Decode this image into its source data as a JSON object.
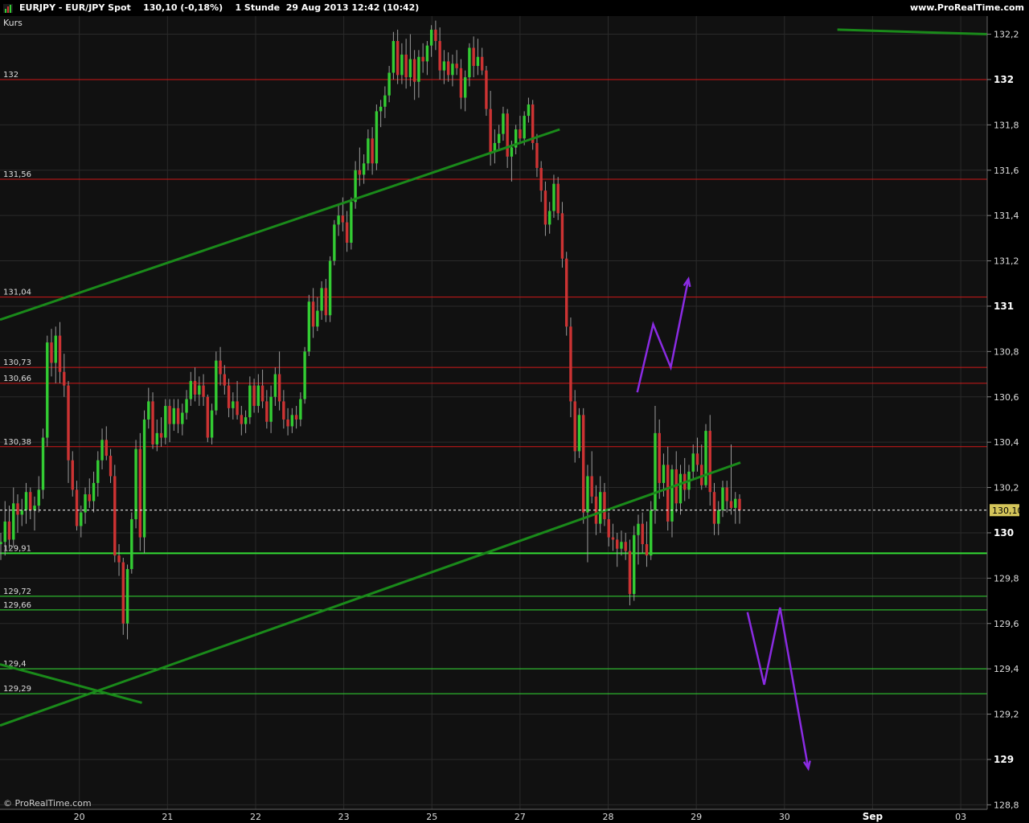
{
  "header": {
    "title": "EURJPY - EUR/JPY Spot    130,10 (-0,18%)    1 Stunde  29 Aug 2013 12:42 (10:42)",
    "site": "www.ProRealTime.com",
    "icon": "bar-chart-icon"
  },
  "footer": {
    "copyright": "© ProRealTime.com"
  },
  "colors": {
    "background": "#111111",
    "up_candle": "#33cc33",
    "down_candle": "#cc3333",
    "resistance": "#d01818",
    "support": "#33dd33",
    "trendline": "#1a8a1a",
    "projection": "#8a2be2"
  },
  "chart_data": {
    "type": "candlestick",
    "instrument": "EURJPY - EUR/JPY Spot",
    "timeframe": "1 Stunde",
    "panel_label": "Kurs",
    "last_price": 130.1,
    "last_price_label": "130,10",
    "change_label": "-0,18%",
    "ylim": [
      128.78,
      132.28
    ],
    "y_axis": {
      "ticks": [
        {
          "v": 132.2,
          "t": "132,2",
          "bold": false
        },
        {
          "v": 132.0,
          "t": "132",
          "bold": true
        },
        {
          "v": 131.8,
          "t": "131,8",
          "bold": false
        },
        {
          "v": 131.6,
          "t": "131,6",
          "bold": false
        },
        {
          "v": 131.4,
          "t": "131,4",
          "bold": false
        },
        {
          "v": 131.2,
          "t": "131,2",
          "bold": false
        },
        {
          "v": 131.0,
          "t": "131",
          "bold": true
        },
        {
          "v": 130.8,
          "t": "130,8",
          "bold": false
        },
        {
          "v": 130.6,
          "t": "130,6",
          "bold": false
        },
        {
          "v": 130.4,
          "t": "130,4",
          "bold": false
        },
        {
          "v": 130.2,
          "t": "130,2",
          "bold": false
        },
        {
          "v": 130.0,
          "t": "130",
          "bold": true
        },
        {
          "v": 129.8,
          "t": "129,8",
          "bold": false
        },
        {
          "v": 129.6,
          "t": "129,6",
          "bold": false
        },
        {
          "v": 129.4,
          "t": "129,4",
          "bold": false
        },
        {
          "v": 129.2,
          "t": "129,2",
          "bold": false
        },
        {
          "v": 129.0,
          "t": "129",
          "bold": true
        },
        {
          "v": 128.8,
          "t": "128,8",
          "bold": false
        }
      ]
    },
    "x_axis": {
      "ticks": [
        {
          "x": 2,
          "t": "20",
          "bold": false
        },
        {
          "x": 12,
          "t": "21",
          "bold": false
        },
        {
          "x": 22,
          "t": "22",
          "bold": false
        },
        {
          "x": 32,
          "t": "23",
          "bold": false
        },
        {
          "x": 42,
          "t": "25",
          "bold": false
        },
        {
          "x": 52,
          "t": "27",
          "bold": false
        },
        {
          "x": 62,
          "t": "28",
          "bold": false
        },
        {
          "x": 72,
          "t": "29",
          "bold": false
        },
        {
          "x": 82,
          "t": "30",
          "bold": false
        },
        {
          "x": 92,
          "t": "Sep",
          "bold": true
        },
        {
          "x": 102,
          "t": "03",
          "bold": false
        }
      ],
      "xlim": [
        -7,
        105
      ]
    },
    "resistance_levels": [
      {
        "v": 132.0,
        "t": "132"
      },
      {
        "v": 131.56,
        "t": "131,56"
      },
      {
        "v": 131.04,
        "t": "131,04"
      },
      {
        "v": 130.73,
        "t": "130,73"
      },
      {
        "v": 130.66,
        "t": "130,66"
      },
      {
        "v": 130.38,
        "t": "130,38"
      }
    ],
    "support_levels": [
      {
        "v": 129.91,
        "t": "129,91",
        "heavy": true
      },
      {
        "v": 129.72,
        "t": "129,72",
        "heavy": false
      },
      {
        "v": 129.66,
        "t": "129,66",
        "heavy": false
      },
      {
        "v": 129.4,
        "t": "129,4",
        "heavy": false
      },
      {
        "v": 129.29,
        "t": "129,29",
        "heavy": false
      }
    ],
    "trendlines": [
      {
        "x1": -7,
        "y1": 130.94,
        "x2": 56.5,
        "y2": 131.78
      },
      {
        "x1": -7,
        "y1": 129.15,
        "x2": 77,
        "y2": 130.31
      },
      {
        "x1": -7,
        "y1": 129.42,
        "x2": 9.1,
        "y2": 129.25
      },
      {
        "x1": 88,
        "y1": 132.22,
        "x2": 105,
        "y2": 132.2
      }
    ],
    "projections": [
      {
        "points": [
          [
            65.3,
            130.62
          ],
          [
            67.1,
            130.92
          ],
          [
            69.1,
            130.73
          ],
          [
            71.1,
            131.12
          ]
        ]
      },
      {
        "points": [
          [
            77.8,
            129.65
          ],
          [
            79.7,
            129.33
          ],
          [
            81.5,
            129.67
          ],
          [
            84.7,
            128.96
          ]
        ]
      }
    ],
    "candles": [
      [
        129.95,
        130.0,
        129.88,
        129.96
      ],
      [
        129.96,
        130.14,
        129.9,
        130.05
      ],
      [
        130.05,
        130.12,
        129.93,
        129.97
      ],
      [
        129.97,
        130.2,
        129.94,
        130.13
      ],
      [
        130.13,
        130.17,
        130.0,
        130.08
      ],
      [
        130.08,
        130.15,
        130.03,
        130.1
      ],
      [
        130.1,
        130.22,
        130.04,
        130.18
      ],
      [
        130.18,
        130.2,
        130.06,
        130.1
      ],
      [
        130.1,
        130.16,
        130.01,
        130.12
      ],
      [
        130.12,
        130.25,
        130.09,
        130.19
      ],
      [
        130.19,
        130.46,
        130.15,
        130.42
      ],
      [
        130.42,
        130.87,
        130.38,
        130.84
      ],
      [
        130.84,
        130.9,
        130.69,
        130.75
      ],
      [
        130.75,
        130.91,
        130.66,
        130.87
      ],
      [
        130.87,
        130.93,
        130.66,
        130.71
      ],
      [
        130.71,
        130.79,
        130.6,
        130.65
      ],
      [
        130.65,
        130.67,
        130.22,
        130.32
      ],
      [
        130.32,
        130.36,
        130.16,
        130.19
      ],
      [
        130.19,
        130.23,
        130.01,
        130.03
      ],
      [
        130.03,
        130.12,
        129.98,
        130.09
      ],
      [
        130.09,
        130.2,
        130.04,
        130.17
      ],
      [
        130.17,
        130.24,
        130.11,
        130.14
      ],
      [
        130.14,
        130.27,
        130.09,
        130.22
      ],
      [
        130.22,
        130.36,
        130.16,
        130.32
      ],
      [
        130.32,
        130.46,
        130.28,
        130.41
      ],
      [
        130.41,
        130.47,
        130.32,
        130.34
      ],
      [
        130.34,
        130.37,
        130.22,
        130.25
      ],
      [
        130.25,
        130.3,
        129.87,
        129.9
      ],
      [
        129.9,
        129.95,
        129.81,
        129.87
      ],
      [
        129.87,
        129.89,
        129.55,
        129.6
      ],
      [
        129.6,
        129.86,
        129.53,
        129.84
      ],
      [
        129.84,
        130.09,
        129.82,
        130.06
      ],
      [
        130.06,
        130.41,
        130.02,
        130.37
      ],
      [
        130.37,
        130.44,
        129.92,
        129.98
      ],
      [
        129.98,
        130.54,
        129.91,
        130.5
      ],
      [
        130.5,
        130.64,
        130.46,
        130.58
      ],
      [
        130.58,
        130.62,
        130.37,
        130.39
      ],
      [
        130.39,
        130.5,
        130.36,
        130.44
      ],
      [
        130.44,
        130.51,
        130.38,
        130.42
      ],
      [
        130.42,
        130.59,
        130.39,
        130.56
      ],
      [
        130.56,
        130.59,
        130.4,
        130.48
      ],
      [
        130.48,
        130.59,
        130.45,
        130.55
      ],
      [
        130.55,
        130.59,
        130.44,
        130.48
      ],
      [
        130.48,
        130.57,
        130.43,
        130.53
      ],
      [
        130.53,
        130.63,
        130.5,
        130.59
      ],
      [
        130.59,
        130.71,
        130.56,
        130.67
      ],
      [
        130.67,
        130.73,
        130.58,
        130.61
      ],
      [
        130.61,
        130.69,
        130.56,
        130.65
      ],
      [
        130.65,
        130.7,
        130.56,
        130.6
      ],
      [
        130.6,
        130.61,
        130.4,
        130.42
      ],
      [
        130.42,
        130.57,
        130.39,
        130.54
      ],
      [
        130.54,
        130.8,
        130.52,
        130.76
      ],
      [
        130.76,
        130.82,
        130.65,
        130.7
      ],
      [
        130.7,
        130.74,
        130.61,
        130.65
      ],
      [
        130.65,
        130.68,
        130.51,
        130.55
      ],
      [
        130.55,
        130.62,
        130.5,
        130.58
      ],
      [
        130.58,
        130.67,
        130.5,
        130.52
      ],
      [
        130.52,
        130.56,
        130.43,
        130.48
      ],
      [
        130.48,
        130.54,
        130.44,
        130.51
      ],
      [
        130.51,
        130.69,
        130.48,
        130.65
      ],
      [
        130.65,
        130.68,
        130.53,
        130.56
      ],
      [
        130.56,
        130.7,
        130.53,
        130.65
      ],
      [
        130.65,
        130.72,
        130.55,
        130.58
      ],
      [
        130.58,
        130.63,
        130.46,
        130.49
      ],
      [
        130.49,
        130.65,
        130.44,
        130.6
      ],
      [
        130.6,
        130.73,
        130.56,
        130.7
      ],
      [
        130.7,
        130.8,
        130.54,
        130.58
      ],
      [
        130.58,
        130.63,
        130.46,
        130.5
      ],
      [
        130.5,
        130.55,
        130.43,
        130.47
      ],
      [
        130.47,
        130.55,
        130.44,
        130.52
      ],
      [
        130.52,
        130.56,
        130.46,
        130.5
      ],
      [
        130.5,
        130.62,
        130.47,
        130.59
      ],
      [
        130.59,
        130.82,
        130.57,
        130.8
      ],
      [
        130.8,
        131.05,
        130.78,
        131.02
      ],
      [
        131.02,
        131.08,
        130.86,
        130.91
      ],
      [
        130.91,
        131.04,
        130.89,
        130.98
      ],
      [
        130.98,
        131.11,
        130.94,
        131.08
      ],
      [
        131.08,
        131.12,
        130.93,
        130.96
      ],
      [
        130.96,
        131.22,
        130.93,
        131.2
      ],
      [
        131.2,
        131.38,
        131.18,
        131.36
      ],
      [
        131.36,
        131.45,
        131.31,
        131.4
      ],
      [
        131.4,
        131.48,
        131.33,
        131.37
      ],
      [
        131.37,
        131.42,
        131.24,
        131.28
      ],
      [
        131.28,
        131.48,
        131.25,
        131.46
      ],
      [
        131.46,
        131.64,
        131.43,
        131.6
      ],
      [
        131.6,
        131.7,
        131.53,
        131.58
      ],
      [
        131.58,
        131.67,
        131.54,
        131.63
      ],
      [
        131.63,
        131.78,
        131.6,
        131.74
      ],
      [
        131.74,
        131.79,
        131.58,
        131.63
      ],
      [
        131.63,
        131.89,
        131.6,
        131.86
      ],
      [
        131.86,
        131.91,
        131.79,
        131.88
      ],
      [
        131.88,
        131.97,
        131.83,
        131.93
      ],
      [
        131.93,
        132.06,
        131.9,
        132.03
      ],
      [
        132.03,
        132.21,
        132.0,
        132.17
      ],
      [
        132.17,
        132.22,
        131.98,
        132.02
      ],
      [
        132.02,
        132.16,
        131.98,
        132.11
      ],
      [
        132.11,
        132.18,
        131.96,
        132.01
      ],
      [
        132.01,
        132.2,
        131.97,
        132.09
      ],
      [
        132.09,
        132.13,
        131.91,
        131.99
      ],
      [
        131.99,
        132.13,
        131.92,
        132.1
      ],
      [
        132.1,
        132.16,
        132.03,
        132.08
      ],
      [
        132.08,
        132.17,
        132.02,
        132.15
      ],
      [
        132.15,
        132.24,
        132.1,
        132.22
      ],
      [
        132.22,
        132.26,
        132.13,
        132.17
      ],
      [
        132.17,
        132.23,
        132.0,
        132.04
      ],
      [
        132.04,
        132.13,
        131.98,
        132.08
      ],
      [
        132.08,
        132.12,
        131.99,
        132.02
      ],
      [
        132.02,
        132.11,
        131.97,
        132.07
      ],
      [
        132.07,
        132.13,
        132.02,
        132.05
      ],
      [
        132.05,
        132.09,
        131.87,
        131.92
      ],
      [
        131.92,
        132.04,
        131.86,
        132.01
      ],
      [
        132.01,
        132.16,
        131.97,
        132.14
      ],
      [
        132.14,
        132.19,
        132.01,
        132.06
      ],
      [
        132.06,
        132.18,
        132.02,
        132.1
      ],
      [
        132.1,
        132.14,
        132.02,
        132.04
      ],
      [
        132.04,
        132.06,
        131.84,
        131.87
      ],
      [
        131.87,
        131.95,
        131.62,
        131.68
      ],
      [
        131.68,
        131.78,
        131.63,
        131.72
      ],
      [
        131.72,
        131.8,
        131.69,
        131.76
      ],
      [
        131.76,
        131.88,
        131.73,
        131.85
      ],
      [
        131.85,
        131.87,
        131.61,
        131.66
      ],
      [
        131.66,
        131.73,
        131.55,
        131.7
      ],
      [
        131.7,
        131.8,
        131.67,
        131.78
      ],
      [
        131.78,
        131.84,
        131.72,
        131.74
      ],
      [
        131.74,
        131.86,
        131.71,
        131.84
      ],
      [
        131.84,
        131.92,
        131.81,
        131.89
      ],
      [
        131.89,
        131.91,
        131.69,
        131.72
      ],
      [
        131.72,
        131.76,
        131.57,
        131.61
      ],
      [
        131.61,
        131.64,
        131.46,
        131.51
      ],
      [
        131.51,
        131.55,
        131.31,
        131.36
      ],
      [
        131.36,
        131.46,
        131.32,
        131.42
      ],
      [
        131.42,
        131.58,
        131.39,
        131.54
      ],
      [
        131.54,
        131.57,
        131.38,
        131.41
      ],
      [
        131.41,
        131.46,
        131.17,
        131.21
      ],
      [
        131.21,
        131.24,
        130.87,
        130.91
      ],
      [
        130.91,
        130.95,
        130.51,
        130.58
      ],
      [
        130.58,
        130.63,
        130.31,
        130.36
      ],
      [
        130.36,
        130.55,
        130.33,
        130.52
      ],
      [
        130.52,
        130.55,
        130.04,
        130.09
      ],
      [
        130.09,
        130.3,
        129.87,
        130.25
      ],
      [
        130.25,
        130.36,
        130.13,
        130.16
      ],
      [
        130.16,
        130.21,
        129.99,
        130.04
      ],
      [
        130.04,
        130.25,
        130.0,
        130.18
      ],
      [
        130.18,
        130.22,
        130.03,
        130.06
      ],
      [
        130.06,
        130.09,
        129.94,
        129.98
      ],
      [
        129.98,
        130.04,
        129.92,
        129.97
      ],
      [
        129.97,
        130.0,
        129.85,
        129.93
      ],
      [
        129.93,
        130.01,
        129.9,
        129.96
      ],
      [
        129.96,
        130.0,
        129.88,
        129.92
      ],
      [
        129.92,
        129.97,
        129.68,
        129.73
      ],
      [
        129.73,
        130.03,
        129.7,
        129.99
      ],
      [
        129.99,
        130.08,
        129.86,
        130.04
      ],
      [
        130.04,
        130.09,
        129.91,
        129.95
      ],
      [
        129.95,
        130.05,
        129.85,
        129.9
      ],
      [
        129.9,
        130.14,
        129.88,
        130.1
      ],
      [
        130.1,
        130.56,
        130.04,
        130.44
      ],
      [
        130.44,
        130.5,
        130.15,
        130.22
      ],
      [
        130.22,
        130.35,
        130.16,
        130.3
      ],
      [
        130.3,
        130.38,
        130.01,
        130.05
      ],
      [
        130.05,
        130.3,
        129.98,
        130.28
      ],
      [
        130.28,
        130.36,
        130.09,
        130.13
      ],
      [
        130.13,
        130.3,
        130.08,
        130.26
      ],
      [
        130.26,
        130.33,
        130.14,
        130.19
      ],
      [
        130.19,
        130.3,
        130.15,
        130.27
      ],
      [
        130.27,
        130.39,
        130.24,
        130.35
      ],
      [
        130.35,
        130.42,
        130.27,
        130.3
      ],
      [
        130.3,
        130.39,
        130.19,
        130.21
      ],
      [
        130.21,
        130.48,
        130.2,
        130.45
      ],
      [
        130.45,
        130.52,
        130.12,
        130.18
      ],
      [
        130.18,
        130.22,
        129.99,
        130.04
      ],
      [
        130.04,
        130.14,
        129.99,
        130.1
      ],
      [
        130.1,
        130.23,
        130.07,
        130.2
      ],
      [
        130.2,
        130.23,
        130.09,
        130.14
      ],
      [
        130.14,
        130.39,
        130.08,
        130.11
      ],
      [
        130.11,
        130.18,
        130.04,
        130.15
      ],
      [
        130.15,
        130.17,
        130.04,
        130.1
      ]
    ]
  }
}
